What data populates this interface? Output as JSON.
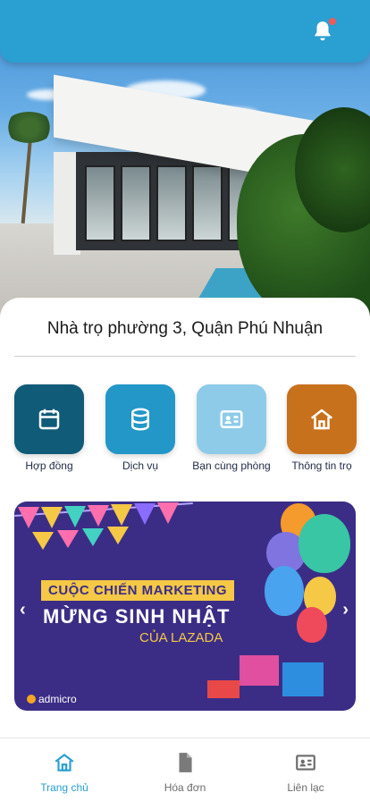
{
  "property": {
    "title": "Nhà trọ phường 3, Quận Phú Nhuận"
  },
  "quick_actions": [
    {
      "label": "Hợp đồng",
      "icon": "calendar-icon",
      "color": "#105b78"
    },
    {
      "label": "Dịch vụ",
      "icon": "database-icon",
      "color": "#2397c7"
    },
    {
      "label": "Bạn cùng phòng",
      "icon": "id-card-icon",
      "color": "#8ecbe8"
    },
    {
      "label": "Thông tin trọ",
      "icon": "home-icon",
      "color": "#c8711c"
    }
  ],
  "banner": {
    "line1": "CUỘC CHIẾN MARKETING",
    "line2": "MỪNG SINH NHẬT",
    "line3": "CỦA LAZADA",
    "brand": "admicro",
    "prev_icon": "chevron-left-icon",
    "next_icon": "chevron-right-icon"
  },
  "bottom_nav": [
    {
      "label": "Trang chủ",
      "icon": "home-icon",
      "active": true
    },
    {
      "label": "Hóa đơn",
      "icon": "document-icon",
      "active": false
    },
    {
      "label": "Liên lạc",
      "icon": "contact-card-icon",
      "active": false
    }
  ],
  "colors": {
    "primary": "#2a9fd1",
    "notification_dot": "#f05a5a",
    "banner_bg": "#3b2d86"
  },
  "topbar": {
    "bell_icon": "bell-icon",
    "has_notification": true
  }
}
